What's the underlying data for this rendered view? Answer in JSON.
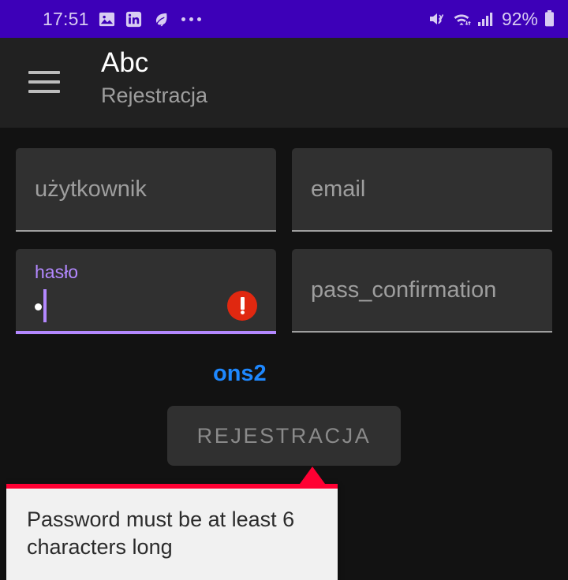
{
  "status_bar": {
    "time": "17:51",
    "battery_percent": "92%",
    "left_icons": [
      "gallery-icon",
      "linkedin-icon",
      "leaf-icon",
      "overflow-dots-icon"
    ],
    "right_icons": [
      "mute-icon",
      "wifi-icon",
      "signal-icon",
      "battery-icon"
    ],
    "background_color": "#3D00B8",
    "foreground_color": "#D8CCF2"
  },
  "app_bar": {
    "menu_icon": "hamburger-menu-icon",
    "title": "Abc",
    "subtitle": "Rejestracja",
    "background_color": "#212121"
  },
  "form": {
    "username_field": {
      "placeholder": "użytkownik",
      "value": ""
    },
    "email_field": {
      "placeholder": "email",
      "value": ""
    },
    "password_field": {
      "label": "hasło",
      "value": "•",
      "error_icon": "error-exclamation-icon",
      "state": "focused-error",
      "accent_color": "#B388FF",
      "error_color": "#E02810"
    },
    "password_confirmation_field": {
      "placeholder": "pass_confirmation",
      "value": ""
    },
    "link_text": "ons2",
    "link_color": "#1E88FF",
    "submit_button": "REJESTRACJA"
  },
  "tooltip": {
    "message": "Password must be at least 6 characters long",
    "accent_color": "#FF0033",
    "background_color": "#F1F1F1"
  }
}
